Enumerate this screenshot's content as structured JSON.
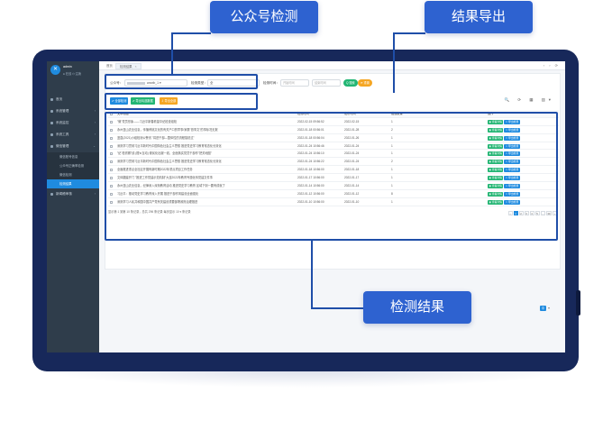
{
  "callouts": {
    "account_check": "公众号检测",
    "export": "结果导出",
    "result": "检测结果"
  },
  "sidebar": {
    "admin": "admin",
    "links": "● 在线  ⏻ 注销",
    "items": [
      {
        "label": "首页"
      },
      {
        "label": "系统管理"
      },
      {
        "label": "系统监控"
      },
      {
        "label": "系统工具"
      },
      {
        "label": "微信管理"
      }
    ],
    "sub_items": [
      {
        "label": "微信账号信息"
      },
      {
        "label": "公众号正确率检测"
      },
      {
        "label": "微信检测"
      },
      {
        "label": "检测结果"
      }
    ],
    "last_item": "新闻稿审核"
  },
  "topbar": {
    "tab_home": "首页",
    "tab_current": "检测结果",
    "tab_close": "×",
    "icons": "‹ ›  ⟳"
  },
  "filters": {
    "account_label": "公众号：",
    "account_value": "wzwib_1",
    "status_label": "检测类型：",
    "status_value": "全",
    "time_label": "检测时间：",
    "time_start": "开始时间",
    "time_end": "结束时间",
    "search_btn": "Q 搜索",
    "reset_btn": "⟳ 重置"
  },
  "actions": {
    "full_check": "✔ 全部检测",
    "export_selected": "✔ 导出勾选数据",
    "export_all": "⇩ 导出全部",
    "tools": "🔍 ⟳ ▦ ▥▾"
  },
  "table": {
    "headers": [
      "文章标题",
      "检测时间",
      "发布时间",
      "错误数量",
      "操作"
    ],
    "rows": [
      {
        "title": "\"微\"党员形象——习近平新春看望中纪检查组检",
        "time": "2022-02-15 09:56:52",
        "pub": "2022-02-15",
        "count": "1"
      },
      {
        "title": "永州蓝山农业信息，传播黄桃文化的有关户口的早事/家委\"首事文\"的事标况无报",
        "time": "2022-01-18 00:56:01",
        "pub": "2022-01-28",
        "count": "2"
      },
      {
        "title": "蓝县(2021)小组检测公警省 \"将进干部—整体性的流程描说过\"",
        "time": "2022-01-18 00:56:04",
        "pub": "2022-01-26",
        "count": "1"
      },
      {
        "title": "深刻学习贯彻习近平新时代中国特色社会主义思想 推进党史学习教育常态化长效化",
        "time": "2022-01-24 10:56:46",
        "pub": "2022-01-24",
        "count": "1"
      },
      {
        "title": "\"纪\"检督察\"线 (理★互动) 便民化出服一线，全面落实党员干部作\"把关地图\"",
        "time": "2022-01-24 10:56:10",
        "pub": "2022-01-24",
        "count": "1"
      },
      {
        "title": "深刻学习贯彻习近平新时代中国特色社会主义思想 推进党史学习教育常态化长效化",
        "time": "2022-01-24 10:56:22",
        "pub": "2022-01-24",
        "count": "2"
      },
      {
        "title": "全面推进重点全社区开展有新时期2022年重点项目工作任务",
        "time": "2022-01-18 10:56:00",
        "pub": "2022-01-18",
        "count": "1"
      },
      {
        "title": "文体翻建开门 \"推进工作党建示范机制\"大连2022年教育专题化传党建文件事",
        "time": "2022-01-17 10:56:00",
        "pub": "2022-01-17",
        "count": "1"
      },
      {
        "title": "永州蓝山农业信息，纪律深入深刻教育活动 推进党史学习教育 区域下到一要有成就了",
        "time": "2022-01-14 10:56:00",
        "pub": "2022-01-14",
        "count": "1"
      },
      {
        "title": "习近平：推动党史学习教育深入开展 推进干部作风建设全面强化",
        "time": "2022-01-12 10:56:00",
        "pub": "2022-01-12",
        "count": "8"
      },
      {
        "title": "深刻学习人民共和国中国共产党有关建设重要部署政府治理推进",
        "time": "2022-01-10 10:56:00",
        "pub": "2022-01-10",
        "count": "1"
      }
    ],
    "op_detail": "◉ 查看详情",
    "op_export": "⇩ 导出检测"
  },
  "footer": {
    "info": "显示第 1 到第 10 条记录，总共 296 条记录  每页显示  10 ▾  条记录",
    "pages": [
      "‹",
      "1",
      "2",
      "3",
      "4",
      "5",
      "...",
      "30",
      "›"
    ],
    "active_page": "1"
  },
  "corner": {
    "box": "中",
    "arrow": "▾"
  }
}
